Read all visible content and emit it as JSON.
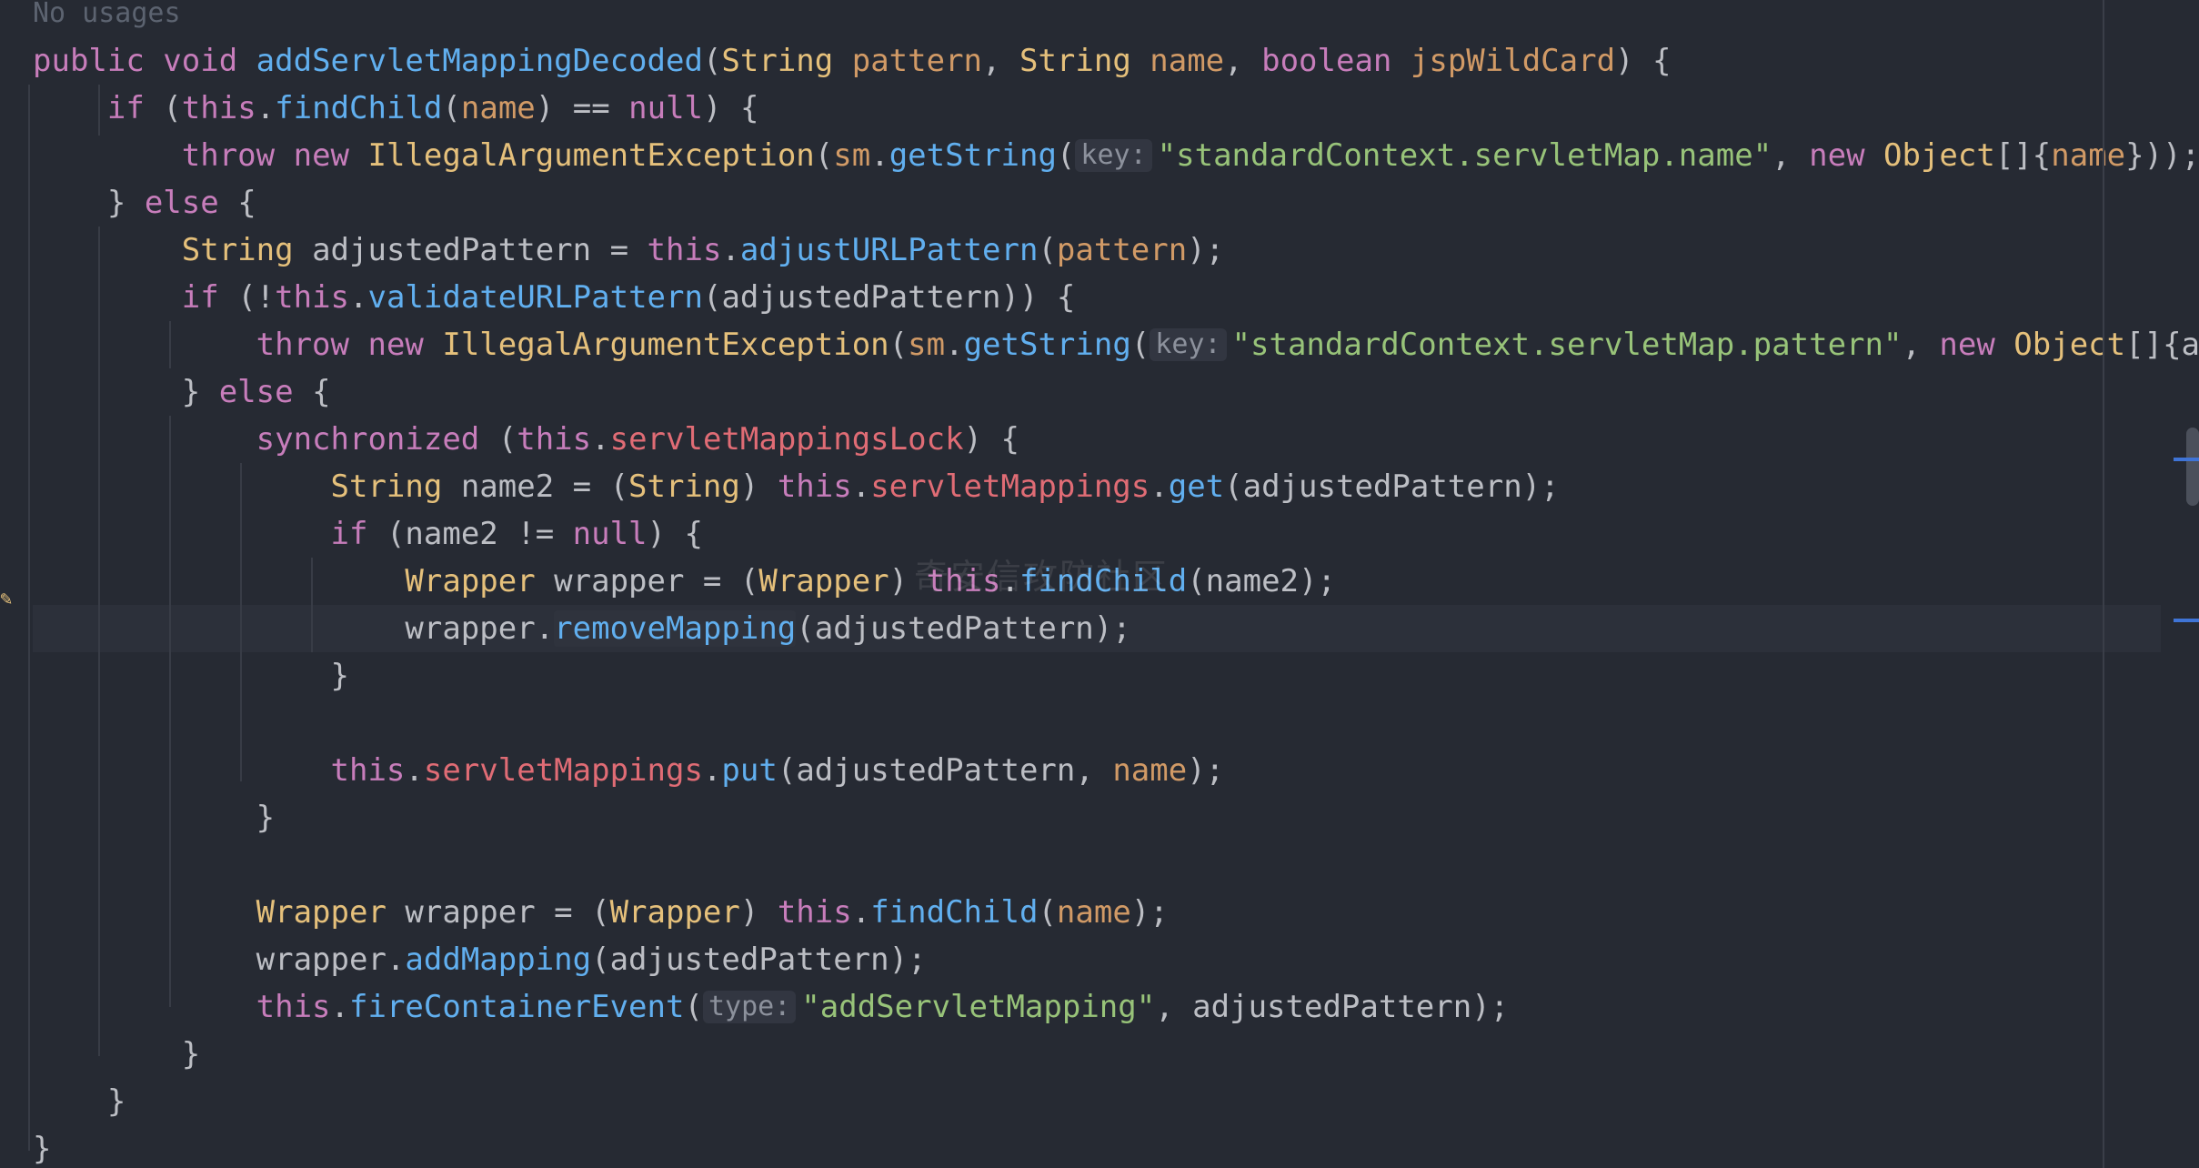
{
  "editor": {
    "usage_hint": "No usages",
    "watermark": "奇安信攻防社区",
    "lines": [
      [
        "hint",
        "No usages"
      ]
    ]
  },
  "code": [
    [
      [
        "kw",
        "public "
      ],
      [
        "kw",
        "void "
      ],
      [
        "fn",
        "addServletMappingDecoded"
      ],
      [
        "pl",
        "("
      ],
      [
        "type",
        "String "
      ],
      [
        "param",
        "pattern"
      ],
      [
        "pl",
        ", "
      ],
      [
        "type",
        "String "
      ],
      [
        "param",
        "name"
      ],
      [
        "pl",
        ", "
      ],
      [
        "kw",
        "boolean "
      ],
      [
        "param",
        "jspWildCard"
      ],
      [
        "pl",
        ") {"
      ]
    ],
    [
      [
        "pl",
        "    "
      ],
      [
        "kw",
        "if "
      ],
      [
        "pl",
        "("
      ],
      [
        "kw",
        "this"
      ],
      [
        "pl",
        "."
      ],
      [
        "fn",
        "findChild"
      ],
      [
        "pl",
        "("
      ],
      [
        "param",
        "name"
      ],
      [
        "pl",
        ") == "
      ],
      [
        "kw",
        "null"
      ],
      [
        "pl",
        ") {"
      ]
    ],
    [
      [
        "pl",
        "        "
      ],
      [
        "kw",
        "throw "
      ],
      [
        "kw",
        "new "
      ],
      [
        "type",
        "IllegalArgumentException"
      ],
      [
        "pl",
        "("
      ],
      [
        "param",
        "sm"
      ],
      [
        "pl",
        "."
      ],
      [
        "fn",
        "getString"
      ],
      [
        "pl",
        "("
      ],
      [
        "hint",
        "key:"
      ],
      [
        "str",
        "\"standardContext.servletMap.name\""
      ],
      [
        "pl",
        ", "
      ],
      [
        "kw",
        "new "
      ],
      [
        "type",
        "Object"
      ],
      [
        "pl",
        "[]{"
      ],
      [
        "param",
        "name"
      ],
      [
        "pl",
        "}));"
      ]
    ],
    [
      [
        "pl",
        "    } "
      ],
      [
        "kw",
        "else "
      ],
      [
        "pl",
        "{"
      ]
    ],
    [
      [
        "pl",
        "        "
      ],
      [
        "type",
        "String "
      ],
      [
        "pl",
        "adjustedPattern = "
      ],
      [
        "kw",
        "this"
      ],
      [
        "pl",
        "."
      ],
      [
        "fn",
        "adjustURLPattern"
      ],
      [
        "pl",
        "("
      ],
      [
        "param",
        "pattern"
      ],
      [
        "pl",
        ");"
      ]
    ],
    [
      [
        "pl",
        "        "
      ],
      [
        "kw",
        "if "
      ],
      [
        "pl",
        "(!"
      ],
      [
        "kw",
        "this"
      ],
      [
        "pl",
        "."
      ],
      [
        "fn",
        "validateURLPattern"
      ],
      [
        "pl",
        "(adjustedPattern)) {"
      ]
    ],
    [
      [
        "pl",
        "            "
      ],
      [
        "kw",
        "throw "
      ],
      [
        "kw",
        "new "
      ],
      [
        "type",
        "IllegalArgumentException"
      ],
      [
        "pl",
        "("
      ],
      [
        "param",
        "sm"
      ],
      [
        "pl",
        "."
      ],
      [
        "fn",
        "getString"
      ],
      [
        "pl",
        "("
      ],
      [
        "hint",
        "key:"
      ],
      [
        "str",
        "\"standardContext.servletMap.pattern\""
      ],
      [
        "pl",
        ", "
      ],
      [
        "kw",
        "new "
      ],
      [
        "type",
        "Object"
      ],
      [
        "pl",
        "[]{adjustedPattern}));"
      ]
    ],
    [
      [
        "pl",
        "        } "
      ],
      [
        "kw",
        "else "
      ],
      [
        "pl",
        "{"
      ]
    ],
    [
      [
        "pl",
        "            "
      ],
      [
        "kw",
        "synchronized "
      ],
      [
        "pl",
        "("
      ],
      [
        "kw",
        "this"
      ],
      [
        "pl",
        "."
      ],
      [
        "field",
        "servletMappingsLock"
      ],
      [
        "pl",
        ") {"
      ]
    ],
    [
      [
        "pl",
        "                "
      ],
      [
        "type",
        "String "
      ],
      [
        "pl",
        "name2 = ("
      ],
      [
        "type",
        "String"
      ],
      [
        "pl",
        ") "
      ],
      [
        "kw",
        "this"
      ],
      [
        "pl",
        "."
      ],
      [
        "field",
        "servletMappings"
      ],
      [
        "pl",
        "."
      ],
      [
        "fn",
        "get"
      ],
      [
        "pl",
        "(adjustedPattern);"
      ]
    ],
    [
      [
        "pl",
        "                "
      ],
      [
        "kw",
        "if "
      ],
      [
        "pl",
        "(name2 != "
      ],
      [
        "kw",
        "null"
      ],
      [
        "pl",
        ") {"
      ]
    ],
    [
      [
        "pl",
        "                    "
      ],
      [
        "type",
        "Wrapper "
      ],
      [
        "pl",
        "wrapper = ("
      ],
      [
        "type",
        "Wrapper"
      ],
      [
        "pl",
        ") "
      ],
      [
        "kw",
        "this"
      ],
      [
        "pl",
        "."
      ],
      [
        "fn",
        "findChild"
      ],
      [
        "pl",
        "(name2);"
      ]
    ],
    [
      [
        "pl",
        "                    wrapper."
      ],
      [
        "fnbox",
        "removeMapping"
      ],
      [
        "pl",
        "(adjustedPattern);"
      ]
    ],
    [
      [
        "pl",
        "                }"
      ]
    ],
    [
      [
        "pl",
        ""
      ]
    ],
    [
      [
        "pl",
        "                "
      ],
      [
        "kw",
        "this"
      ],
      [
        "pl",
        "."
      ],
      [
        "field",
        "servletMappings"
      ],
      [
        "pl",
        "."
      ],
      [
        "fn",
        "put"
      ],
      [
        "pl",
        "(adjustedPattern, "
      ],
      [
        "param",
        "name"
      ],
      [
        "pl",
        ");"
      ]
    ],
    [
      [
        "pl",
        "            }"
      ]
    ],
    [
      [
        "pl",
        ""
      ]
    ],
    [
      [
        "pl",
        "            "
      ],
      [
        "type",
        "Wrapper "
      ],
      [
        "pl",
        "wrapper = ("
      ],
      [
        "type",
        "Wrapper"
      ],
      [
        "pl",
        ") "
      ],
      [
        "kw",
        "this"
      ],
      [
        "pl",
        "."
      ],
      [
        "fn",
        "findChild"
      ],
      [
        "pl",
        "("
      ],
      [
        "param",
        "name"
      ],
      [
        "pl",
        ");"
      ]
    ],
    [
      [
        "pl",
        "            wrapper."
      ],
      [
        "fn",
        "addMapping"
      ],
      [
        "pl",
        "(adjustedPattern);"
      ]
    ],
    [
      [
        "pl",
        "            "
      ],
      [
        "kw",
        "this"
      ],
      [
        "pl",
        "."
      ],
      [
        "fn",
        "fireContainerEvent"
      ],
      [
        "pl",
        "("
      ],
      [
        "hint",
        "type:"
      ],
      [
        "str",
        "\"addServletMapping\""
      ],
      [
        "pl",
        ", adjustedPattern);"
      ]
    ],
    [
      [
        "pl",
        "        }"
      ]
    ],
    [
      [
        "pl",
        "    }"
      ]
    ],
    [
      [
        "pl",
        "}"
      ]
    ]
  ],
  "current_line": 13,
  "colors": {
    "background": "#262a33",
    "keyword": "#c77dbb",
    "type": "#e5c07b",
    "function": "#61afef",
    "string": "#98c379",
    "field": "#e06c75",
    "parameter": "#d19a66",
    "plain": "#bcbec4"
  }
}
